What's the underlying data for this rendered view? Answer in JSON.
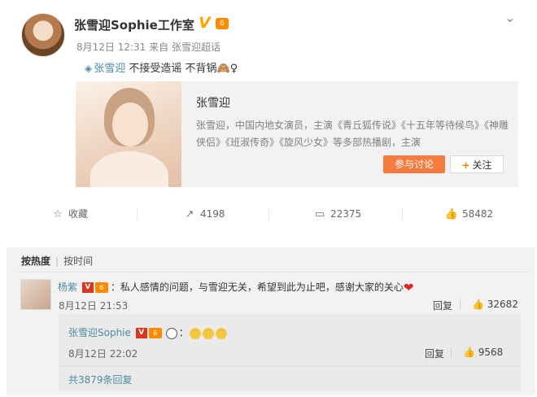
{
  "post": {
    "author": "张雪迎Sophie工作室",
    "verified_icon": "v-verified-icon",
    "level_icon": "vip-level-icon",
    "time": "8月12日 12:31",
    "source": "来自 张雪迎超话",
    "topic": "张雪迎",
    "text": " 不接受造谣 不背锅",
    "text_icons": "🙈♀"
  },
  "card": {
    "title": "张雪迎",
    "description": "张雪迎，中国内地女演员，主演《青丘狐传说》《十五年等待候鸟》《神雕侠侣》《班淑传奇》《旋风少女》等多部热播剧，主演",
    "join_label": "参与讨论",
    "follow_plus": "+",
    "follow_label": "关注"
  },
  "actions": {
    "favorite_label": "收藏",
    "repost_count": "4198",
    "comment_count": "22375",
    "like_count": "58482"
  },
  "comments": {
    "sort_hot": "按热度",
    "sort_time": "按时间",
    "main": {
      "author": "杨紫",
      "v_badge": "V",
      "level_badge": "6",
      "text": "：私人感情的问题，与雪迎无关，希望到此为止吧，感谢大家的关心",
      "date": "8月12日 21:53",
      "reply_label": "回复",
      "likes": "32682"
    },
    "sub": {
      "author": "张雪迎Sophie",
      "v_badge": "V",
      "level_badge": "6",
      "colon": "：",
      "date": "8月12日 22:02",
      "reply_label": "回复",
      "likes": "9568",
      "more": "共3879条回复"
    }
  },
  "colors": {
    "link": "#4c8ba3",
    "accent_orange": "#f57b3f",
    "heart": "#e0262b"
  }
}
